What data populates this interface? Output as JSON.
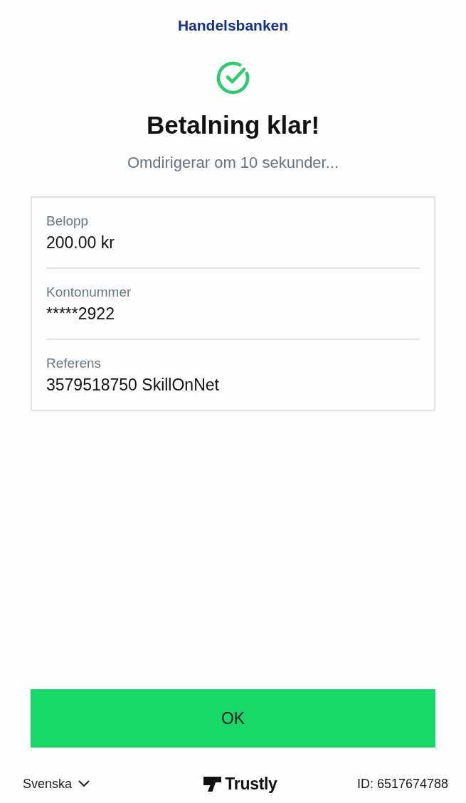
{
  "header": {
    "bank_name": "Handelsbanken"
  },
  "status": {
    "title": "Betalning klar!",
    "subtitle": "Omdirigerar om 10 sekunder..."
  },
  "details": [
    {
      "label": "Belopp",
      "value": "200.00 kr"
    },
    {
      "label": "Kontonummer",
      "value": "*****2922"
    },
    {
      "label": "Referens",
      "value": "3579518750 SkillOnNet"
    }
  ],
  "ok_button": {
    "label": "OK"
  },
  "footer": {
    "language": "Svenska",
    "brand": "Trustly",
    "id": "ID: 6517674788"
  }
}
